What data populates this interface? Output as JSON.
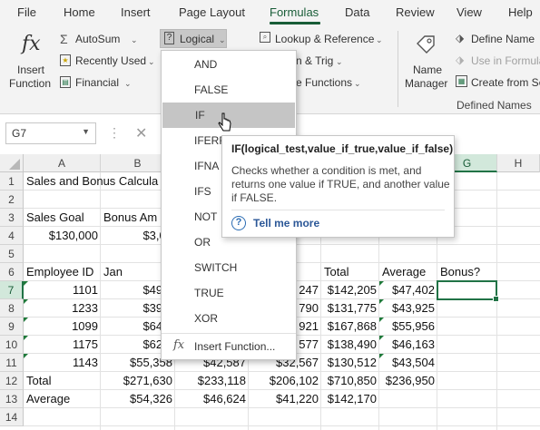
{
  "tabs": [
    "File",
    "Home",
    "Insert",
    "Page Layout",
    "Formulas",
    "Data",
    "Review",
    "View",
    "Help"
  ],
  "active_tab": "Formulas",
  "ribbon": {
    "insert_function": [
      "Insert",
      "Function"
    ],
    "autosum": "AutoSum",
    "recently_used": "Recently Used",
    "financial": "Financial",
    "logical": "Logical",
    "lookup_reference": "Lookup & Reference",
    "math_trig_partial": "n & Trig",
    "more_functions_partial": "e Functions",
    "name_manager": [
      "Name",
      "Manager"
    ],
    "define_name": "Define Name",
    "use_in_formula": "Use in Formula",
    "create_from_selection": "Create from Se",
    "group_defined_names": "Defined Names"
  },
  "formula_bar": {
    "name_box": "G7"
  },
  "columns": [
    "A",
    "B",
    "C",
    "D",
    "E",
    "F",
    "G",
    "H"
  ],
  "selected_column": "G",
  "rows": [
    "1",
    "2",
    "3",
    "4",
    "5",
    "6",
    "7",
    "8",
    "9",
    "10",
    "11",
    "12",
    "13",
    "14"
  ],
  "selected_row": "7",
  "cells": {
    "r1": {
      "a": "Sales and Bonus Calcula"
    },
    "r3": {
      "a": "Sales Goal",
      "b": "Bonus Am"
    },
    "r4": {
      "a": "$130,000",
      "b": "$3,00"
    },
    "r6": {
      "a": "Employee ID",
      "b": "Jan",
      "e": "Total",
      "f": "Average",
      "g": "Bonus?"
    },
    "r7": {
      "a": "1101",
      "b": "$49,8",
      "d": "247",
      "e": "$142,205",
      "f": "$47,402"
    },
    "r8": {
      "a": "1233",
      "b": "$39,2",
      "d": "790",
      "e": "$131,775",
      "f": "$43,925"
    },
    "r9": {
      "a": "1099",
      "b": "$64,3",
      "d": "921",
      "e": "$167,868",
      "f": "$55,956"
    },
    "r10": {
      "a": "1175",
      "b": "$62,8",
      "d": "577",
      "e": "$138,490",
      "f": "$46,163"
    },
    "r11": {
      "a": "1143",
      "b": "$55,358",
      "c": "$42,587",
      "d": "$32,567",
      "e": "$130,512",
      "f": "$43,504"
    },
    "r12": {
      "a": "Total",
      "b": "$271,630",
      "c": "$233,118",
      "d": "$206,102",
      "e": "$710,850",
      "f": "$236,950"
    },
    "r13": {
      "a": "Average",
      "b": "$54,326",
      "c": "$46,624",
      "d": "$41,220",
      "e": "$142,170"
    }
  },
  "dropdown": {
    "items": [
      "AND",
      "FALSE",
      "IF",
      "IFERR",
      "IFNA",
      "IFS",
      "NOT",
      "OR",
      "SWITCH",
      "TRUE",
      "XOR"
    ],
    "hovered": "IF",
    "insert_function": "Insert Function..."
  },
  "tooltip": {
    "signature": "IF(logical_test,value_if_true,value_if_false)",
    "description_lines": [
      "Checks whether a condition is met, and",
      "returns one value if TRUE, and another value",
      "if FALSE."
    ],
    "link": "Tell me more"
  },
  "colors": {
    "accent": "#217346",
    "tab_active": "#185c37",
    "hover": "#c5c5c5"
  },
  "icons": [
    "fx-icon",
    "sigma-icon",
    "star-book-icon",
    "book-icon",
    "question-book-icon",
    "lookup-icon",
    "tag-icon",
    "name-manager-icon",
    "help-circle-icon",
    "mouse-cursor-icon"
  ]
}
